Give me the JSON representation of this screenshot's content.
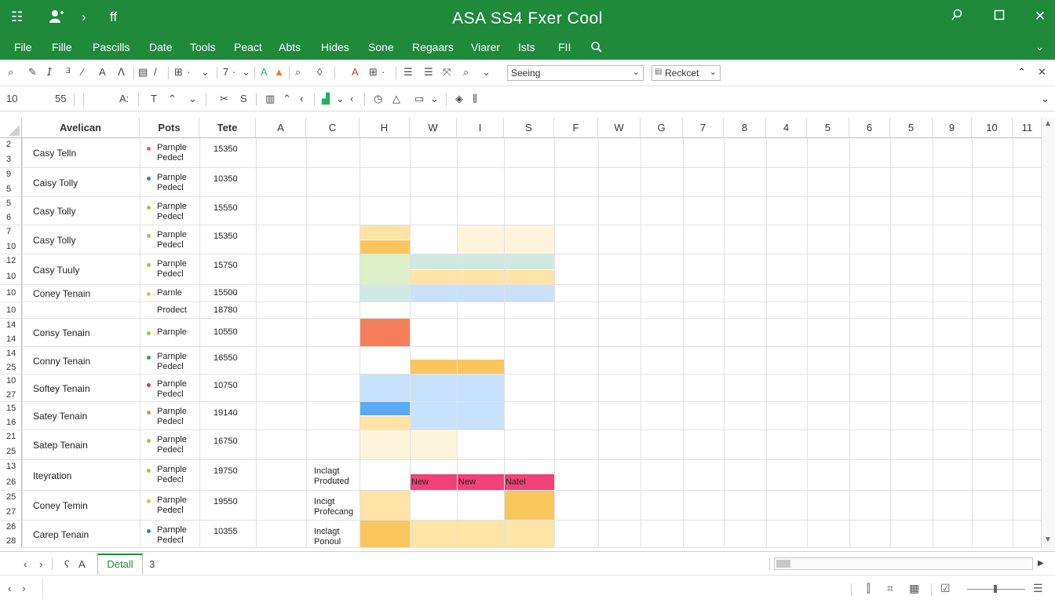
{
  "title": "ASA SS4 Fxer Cool",
  "titlebar_icons": [
    "grid-menu-icon",
    "user-icon",
    "chevron-right-icon",
    "format-icon"
  ],
  "window_controls": [
    "search-icon",
    "restore-icon",
    "close-icon"
  ],
  "menu": [
    "File",
    "Fille",
    "Pascills",
    "Date",
    "Tools",
    "Peact",
    "Abts",
    "Hides",
    "Sone",
    "Regaars",
    "Viarer",
    "Ists",
    "FII"
  ],
  "ribbon": {
    "style_combo": "Seeing",
    "font_combo": "Reckcet",
    "cell_ref": "10",
    "font_size": "55",
    "font_label": "A:"
  },
  "columns": [
    {
      "label": "Avelican",
      "bold": true
    },
    {
      "label": "Pots",
      "bold": true
    },
    {
      "label": "Tete",
      "bold": true
    },
    {
      "label": "A"
    },
    {
      "label": "C"
    },
    {
      "label": "H"
    },
    {
      "label": "W"
    },
    {
      "label": "I"
    },
    {
      "label": "S"
    },
    {
      "label": "F"
    },
    {
      "label": "W"
    },
    {
      "label": "G"
    },
    {
      "label": "7"
    },
    {
      "label": "8"
    },
    {
      "label": "4"
    },
    {
      "label": "5"
    },
    {
      "label": "6"
    },
    {
      "label": "5"
    },
    {
      "label": "9"
    },
    {
      "label": "10"
    },
    {
      "label": "11"
    }
  ],
  "rows": [
    {
      "nums": [
        "2",
        "3"
      ],
      "name": "Casy Telln",
      "p1": "Parnple",
      "p2": "Pedecl",
      "tete": "15350",
      "dot": "#e86a4a"
    },
    {
      "nums": [
        "9",
        "5"
      ],
      "name": "Caisy Tolly",
      "p1": "Parnple",
      "p2": "Pedecl",
      "tete": "10350",
      "dot": "#2b7fc7"
    },
    {
      "nums": [
        "5",
        "6"
      ],
      "name": "Casy Tolly",
      "p1": "Parnple",
      "p2": "Pedecl",
      "tete": "15550",
      "dot": "#9acd32"
    },
    {
      "nums": [
        "7",
        "10"
      ],
      "name": "Casy Tolly",
      "p1": "Parnple",
      "p2": "Pedecl",
      "tete": "15350",
      "dot": "#9acd32"
    },
    {
      "nums": [
        "12",
        "10"
      ],
      "name": "Casy Tuuly",
      "p1": "Parnple",
      "p2": "Pedecl",
      "tete": "15750",
      "dot": "#9acd32"
    },
    {
      "nums": [
        "10"
      ],
      "name": "Coney Tenain",
      "p1": "Parnle",
      "p2": "",
      "tete": "15500",
      "dot": "#e6c229"
    },
    {
      "nums": [
        "10"
      ],
      "name": "",
      "p1": "Prodect",
      "p2": "",
      "tete": "18780",
      "dot": ""
    },
    {
      "nums": [
        "14",
        "14"
      ],
      "name": "Consy Tenain",
      "p1": "Parnple",
      "p2": "",
      "tete": "10550",
      "dot": "#9acd32"
    },
    {
      "nums": [
        "14",
        "25"
      ],
      "name": "Conny Tenain",
      "p1": "Parnple",
      "p2": "Pedecl",
      "tete": "16550",
      "dot": "#3aa55a"
    },
    {
      "nums": [
        "10",
        "27"
      ],
      "name": "Softey Tenain",
      "p1": "Parnple",
      "p2": "Pedecl",
      "tete": "10750",
      "dot": "#d94040"
    },
    {
      "nums": [
        "15",
        "16"
      ],
      "name": "Satey Tenain",
      "p1": "Parnple",
      "p2": "Pedecl",
      "tete": "19140",
      "dot": "#e8904a"
    },
    {
      "nums": [
        "21",
        "25"
      ],
      "name": "Satep Tenain",
      "p1": "Parnple",
      "p2": "Pedecl",
      "tete": "16750",
      "dot": "#9acd32"
    },
    {
      "nums": [
        "13",
        "26"
      ],
      "name": "Iteyration",
      "p1": "Parnple",
      "p2": "Pedecl",
      "tete": "19750",
      "dot": "#9acd32",
      "c1": "Inclagt",
      "c2": "Produted"
    },
    {
      "nums": [
        "25",
        "27"
      ],
      "name": "Coney Temin",
      "p1": "Parnple",
      "p2": "Pedecl",
      "tete": "19550",
      "dot": "#e6c229",
      "c1": "Incigt",
      "c2": "Profecang"
    },
    {
      "nums": [
        "26",
        "28"
      ],
      "name": "Carep Tenain",
      "p1": "Parnple",
      "p2": "Pedecl",
      "tete": "10355",
      "dot": "#2b7fc7",
      "c1": "Inclagt",
      "c2": "Ponoul"
    }
  ],
  "highlight_labels": {
    "new1": "New",
    "new2": "New",
    "natel": "Natel"
  },
  "colors": {
    "brand_green": "#1f8a3a",
    "light_orange": "#fde3a6",
    "orange": "#f9c65e",
    "light_yellow": "#fdf4dc",
    "light_green": "#dcefc7",
    "light_teal": "#cfe9e2",
    "light_blue": "#c8e2fb",
    "blue": "#5aaaf5",
    "coral": "#f3805a",
    "pink": "#f2417a"
  },
  "sheet_tabs": {
    "active": "Detall",
    "other": "3",
    "nav_label": "A"
  },
  "status_icons": [
    "grid-view-icon",
    "hash-icon",
    "page-layout-icon",
    "edit-icon",
    "zoom-slider",
    "settings-icon"
  ]
}
